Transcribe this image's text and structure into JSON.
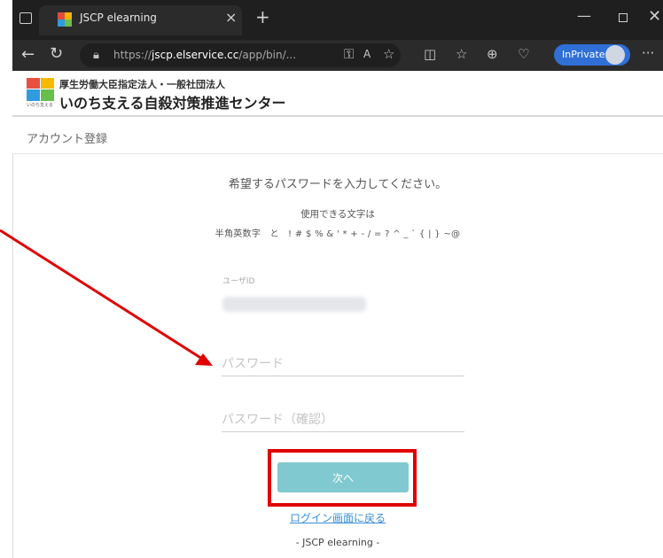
{
  "browser": {
    "tab_title": "JSCP elearning",
    "tab_close": "×",
    "new_tab": "+",
    "url_prefix": "https://",
    "url_domain": "jscp.elservice.cc",
    "url_path": "/app/bin/...",
    "inprivate_label": "InPrivate",
    "window_min": "—",
    "window_close": "✕",
    "menu_dots": "···"
  },
  "header": {
    "org_line1": "厚生労働大臣指定法人・一般社団法人",
    "org_line2": "いのち支える自殺対策推進センター",
    "logo_sub": "いのち支える"
  },
  "breadcrumb": "アカウント登録",
  "form": {
    "instruction": "希望するパスワードを入力してください。",
    "chars_title": "使用できる文字は",
    "chars_line": "半角英数字　と　! # $ % & ' * + - / = ? ^ _ ` { | } ~@",
    "userid_label": "ユーザID",
    "password_placeholder": "パスワード",
    "password_confirm_placeholder": "パスワード（確認）",
    "next_button": "次へ",
    "back_link": "ログイン画面に戻る"
  },
  "footer": "- JSCP elearning -",
  "colors": {
    "annotation_red": "#e00000",
    "button_teal": "#80c9d0",
    "link_blue": "#3a8fd1",
    "inprivate_blue": "#2f6fd6"
  }
}
